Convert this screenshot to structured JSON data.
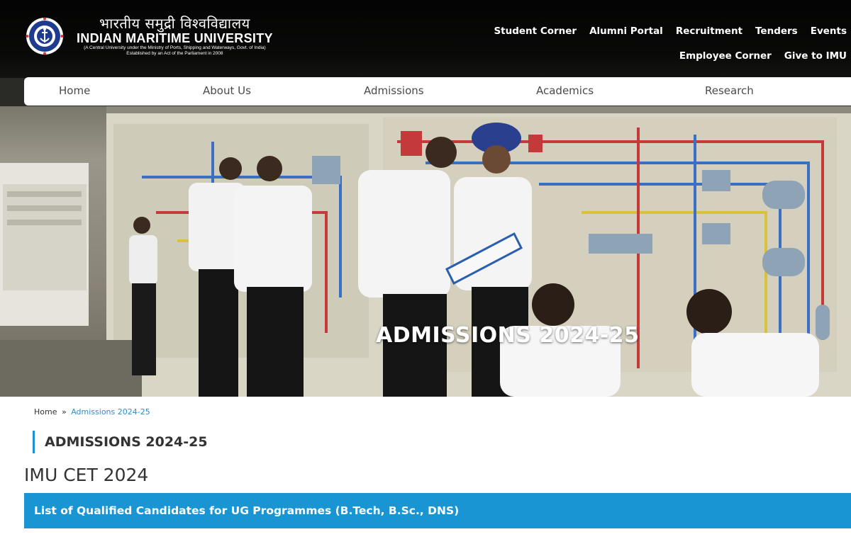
{
  "header": {
    "logo_hindi": "भारतीय समुद्री विश्वविद्यालय",
    "logo_name": "INDIAN MARITIME UNIVERSITY",
    "logo_sub1": "(A Central University under the Ministry of Ports, Shipping and Waterways, Govt. of India)",
    "logo_sub2": "Established by an Act of the Parliament in 2008",
    "top_links_row1": [
      "Student Corner",
      "Alumni Portal",
      "Recruitment",
      "Tenders",
      "Events"
    ],
    "top_links_row2": [
      "Employee Corner",
      "Give to IMU"
    ]
  },
  "nav": {
    "items": [
      "Home",
      "About Us",
      "Admissions",
      "Academics",
      "Research"
    ]
  },
  "hero": {
    "title": "ADMISSIONS 2024-25"
  },
  "breadcrumb": {
    "home": "Home",
    "separator": "»",
    "current": "Admissions 2024-25"
  },
  "content": {
    "section_heading": "ADMISSIONS 2024-25",
    "subtitle": "IMU CET 2024",
    "accordion_label": "List of Qualified Candidates for UG Programmes (B.Tech, B.Sc., DNS)"
  },
  "colors": {
    "accent_blue": "#1a95d4",
    "link_blue": "#2a8fc4"
  }
}
